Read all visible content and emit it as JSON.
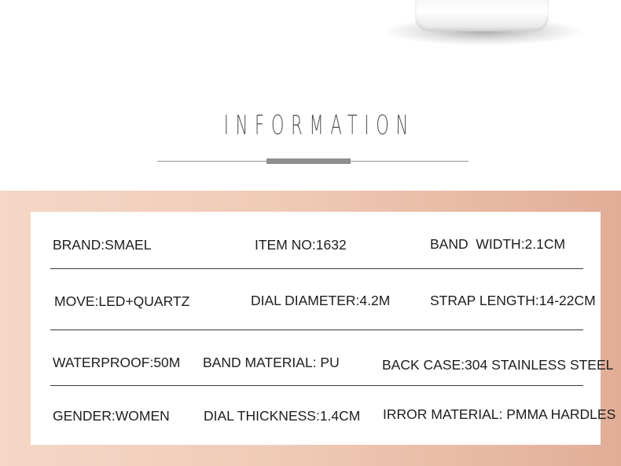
{
  "heading": "INFORMATION",
  "specs": [
    [
      "BRAND:SMAEL",
      "ITEM NO:1632",
      "BAND  WIDTH:2.1CM"
    ],
    [
      "MOVE:LED+QUARTZ",
      "DIAL DIAMETER:4.2M",
      "STRAP LENGTH:14-22CM"
    ],
    [
      "WATERPROOF:50M",
      "BAND MATERIAL: PU",
      "BACK CASE:304 STAINLESS STEEL"
    ],
    [
      "GENDER:WOMEN",
      "DIAL THICKNESS:1.4CM",
      "IRROR MATERIAL: PMMA HARDLES"
    ]
  ],
  "colors": {
    "band_left": "#f4d7c6",
    "band_right": "#e2ad97",
    "text": "#1e1e1e",
    "heading": "#555555"
  }
}
